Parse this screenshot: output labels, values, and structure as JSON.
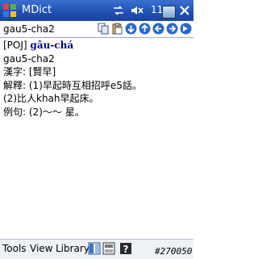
{
  "titlebar": {
    "start_icon": "windows-flag-icon",
    "title": "MDict",
    "time": "11:0",
    "indicators": [
      "connectivity-icon",
      "volume-muted-icon",
      "small-window-icon"
    ]
  },
  "toolbar": {
    "query": "gau5-cha2",
    "buttons": [
      "copy-icon",
      "paste-icon",
      "back-icon",
      "history-icon",
      "previous-icon",
      "next-icon"
    ]
  },
  "entry": {
    "poj_label": "[POJ]",
    "poj_word": "gâu-chá",
    "romanization": "gau5-cha2",
    "hanzi_label": "漢字:",
    "hanzi": "[賢早]",
    "definition_label": "解釋:",
    "definition_1": "(1)早起時互相招呼e5話。",
    "definition_2": "(2)比人khah早起床。",
    "example_label": "例句:",
    "example": "(2)～～ 星。"
  },
  "menubar": {
    "tools": "Tools",
    "view": "View",
    "library": "Library",
    "icons": [
      "split-view-icon",
      "keyboard-icon",
      "help-icon"
    ]
  },
  "watermark": "#270050"
}
